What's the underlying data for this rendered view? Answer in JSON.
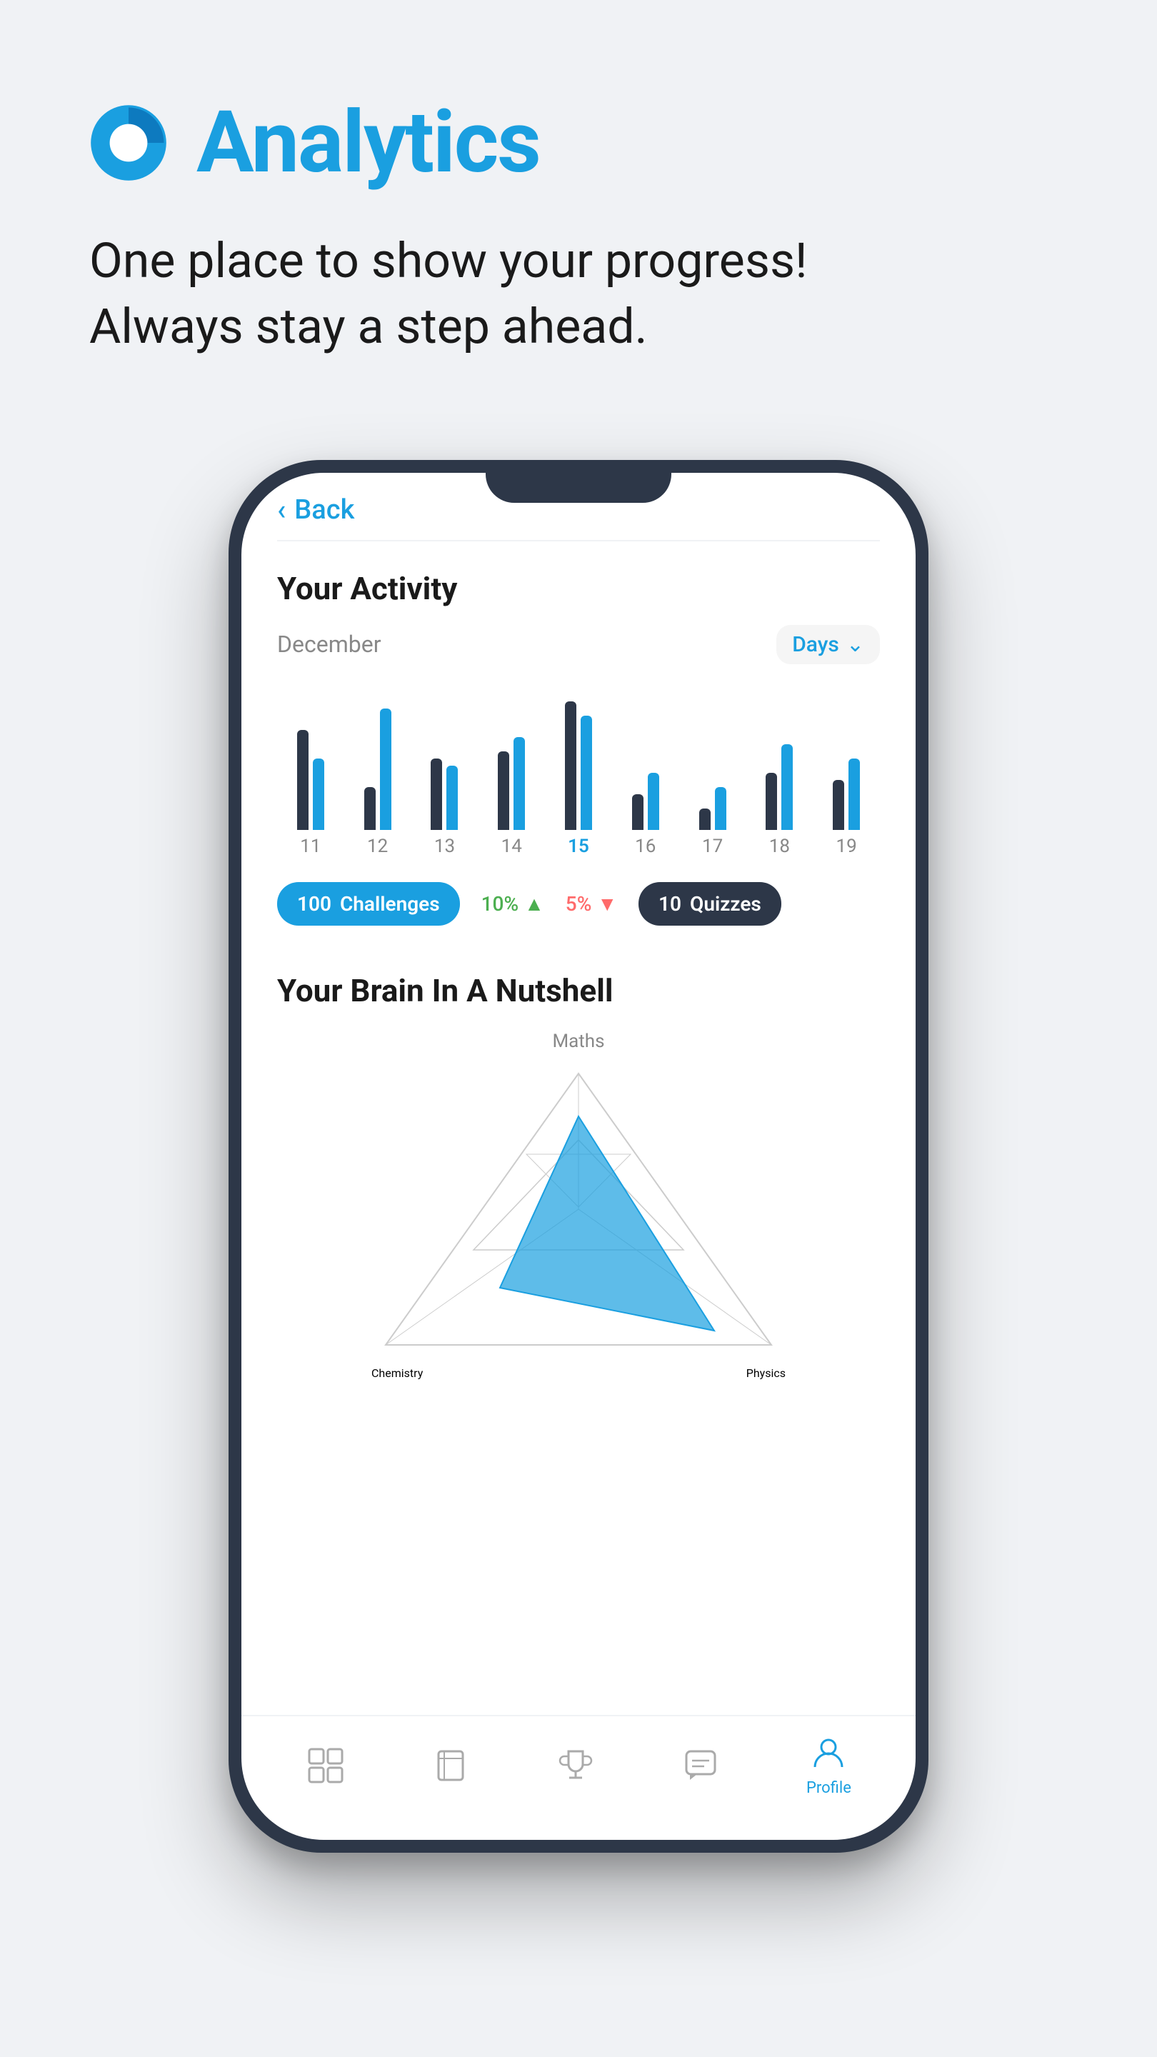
{
  "header": {
    "title": "Analytics",
    "subtitle_line1": "One place to show your progress!",
    "subtitle_line2": "Always stay a step ahead.",
    "icon_color": "#1a9fe0"
  },
  "phone": {
    "back_label": "Back",
    "activity": {
      "title": "Your Activity",
      "month": "December",
      "filter": "Days",
      "bars": [
        {
          "day": "11",
          "dark_height": 140,
          "blue_height": 100,
          "active": false
        },
        {
          "day": "12",
          "dark_height": 60,
          "blue_height": 170,
          "active": false
        },
        {
          "day": "13",
          "dark_height": 100,
          "blue_height": 90,
          "active": false
        },
        {
          "day": "14",
          "dark_height": 110,
          "blue_height": 130,
          "active": false
        },
        {
          "day": "15",
          "dark_height": 180,
          "blue_height": 160,
          "active": true
        },
        {
          "day": "16",
          "dark_height": 50,
          "blue_height": 80,
          "active": false
        },
        {
          "day": "17",
          "dark_height": 30,
          "blue_height": 60,
          "active": false
        },
        {
          "day": "18",
          "dark_height": 80,
          "blue_height": 120,
          "active": false
        },
        {
          "day": "19",
          "dark_height": 70,
          "blue_height": 100,
          "active": false
        }
      ],
      "stats": {
        "challenges_count": "100",
        "challenges_label": "Challenges",
        "percent_up": "10%",
        "percent_down": "5%",
        "quizzes_count": "10",
        "quizzes_label": "Quizzes"
      }
    },
    "brain": {
      "title": "Your Brain In A Nutshell",
      "labels": {
        "top": "Maths",
        "bottom_left": "Chemistry",
        "bottom_right": "Physics"
      }
    },
    "nav": {
      "items": [
        {
          "label": "",
          "active": false,
          "icon": "grid"
        },
        {
          "label": "",
          "active": false,
          "icon": "book"
        },
        {
          "label": "",
          "active": false,
          "icon": "trophy"
        },
        {
          "label": "",
          "active": false,
          "icon": "chat"
        },
        {
          "label": "Profile",
          "active": true,
          "icon": "person"
        }
      ]
    }
  }
}
